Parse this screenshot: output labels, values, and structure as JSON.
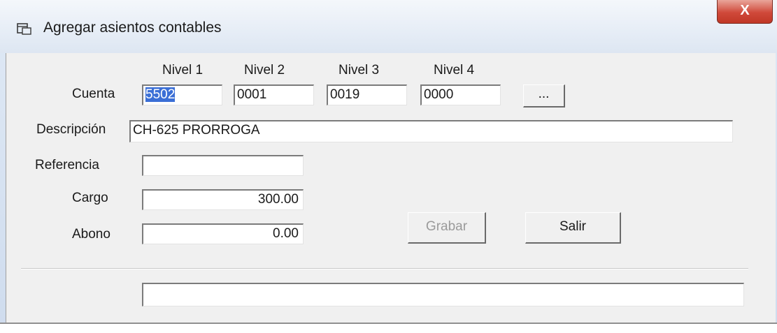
{
  "window": {
    "title": "Agregar asientos contables",
    "close_glyph": "X"
  },
  "levels": {
    "nivel1": "Nivel 1",
    "nivel2": "Nivel 2",
    "nivel3": "Nivel 3",
    "nivel4": "Nivel 4"
  },
  "labels": {
    "cuenta": "Cuenta",
    "descripcion": "Descripción",
    "referencia": "Referencia",
    "cargo": "Cargo",
    "abono": "Abono"
  },
  "fields": {
    "cuenta_nivel1": "5502",
    "cuenta_nivel2": "0001",
    "cuenta_nivel3": "0019",
    "cuenta_nivel4": "0000",
    "descripcion": "CH-625 PRORROGA",
    "referencia": "",
    "cargo": "300.00",
    "abono": "0.00",
    "status": ""
  },
  "buttons": {
    "browse": "...",
    "grabar": "Grabar",
    "salir": "Salir"
  },
  "colors": {
    "selection": "#3b6fd6",
    "close": "#c9483a"
  }
}
